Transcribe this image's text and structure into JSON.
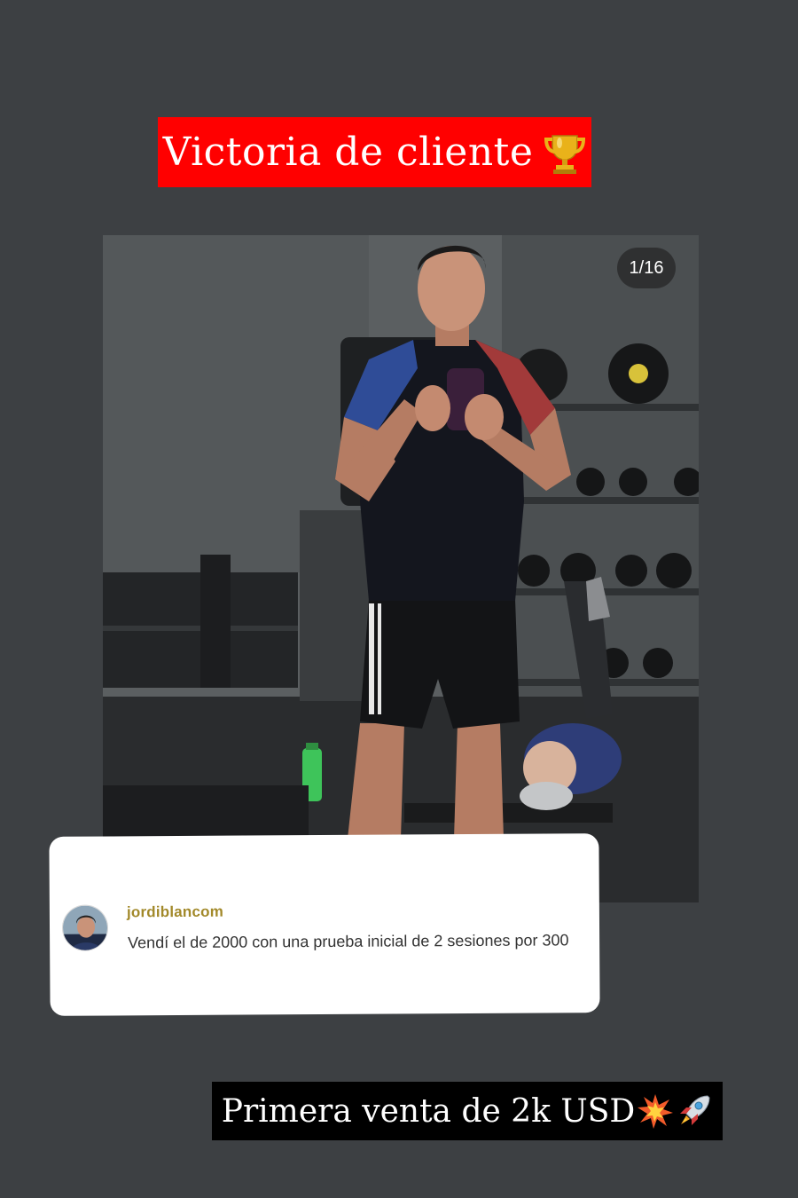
{
  "story": {
    "title": "Victoria de cliente",
    "title_icon": "trophy-icon",
    "caption": "Primera venta de 2k USD",
    "caption_icons": [
      "explosion-icon",
      "rocket-icon"
    ]
  },
  "post": {
    "page_counter": "1/16",
    "photo_subject": "gym-mirror-selfie"
  },
  "comment": {
    "username": "jordiblancom",
    "text": "Vendí el de 2000 con una prueba inicial de 2 sesiones por 300"
  },
  "colors": {
    "background": "#3d4043",
    "title_banner": "#ff0000",
    "caption_banner": "#000000",
    "username": "#a2892a"
  }
}
